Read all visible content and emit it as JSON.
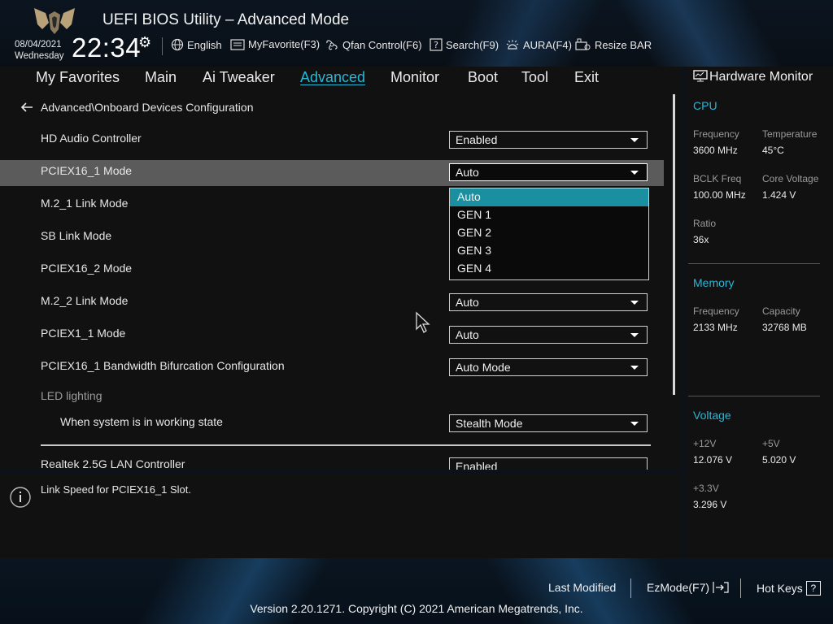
{
  "header": {
    "title": "UEFI BIOS Utility – Advanced Mode",
    "date": "08/04/2021",
    "weekday": "Wednesday",
    "time": "22:34",
    "items": [
      {
        "label": "English",
        "icon": "globe-icon"
      },
      {
        "label": "MyFavorite(F3)",
        "icon": "favorite-icon"
      },
      {
        "label": "Qfan Control(F6)",
        "icon": "fan-icon"
      },
      {
        "label": "Search(F9)",
        "icon": "search-icon"
      },
      {
        "label": "AURA(F4)",
        "icon": "aura-icon"
      },
      {
        "label": "Resize BAR",
        "icon": "resize-bar-icon"
      }
    ]
  },
  "menu": {
    "tabs": [
      "My Favorites",
      "Main",
      "Ai Tweaker",
      "Advanced",
      "Monitor",
      "Boot",
      "Tool",
      "Exit"
    ],
    "active": "Advanced"
  },
  "main": {
    "breadcrumb": "Advanced\\Onboard Devices Configuration",
    "rows": [
      {
        "label": "HD Audio Controller",
        "value": "Enabled"
      },
      {
        "label": "PCIEX16_1 Mode",
        "value": "Auto"
      },
      {
        "label": "M.2_1 Link Mode",
        "value": ""
      },
      {
        "label": "SB Link Mode",
        "value": ""
      },
      {
        "label": "PCIEX16_2 Mode",
        "value": ""
      },
      {
        "label": "M.2_2 Link Mode",
        "value": "Auto"
      },
      {
        "label": "PCIEX1_1 Mode",
        "value": "Auto"
      },
      {
        "label": "PCIEX16_1 Bandwidth Bifurcation Configuration",
        "value": "Auto Mode"
      },
      {
        "label": "LED lighting",
        "value": ""
      },
      {
        "label": "When system is in working state",
        "value": "Stealth Mode"
      },
      {
        "label": "Realtek 2.5G LAN Controller",
        "value": "Enabled"
      }
    ],
    "dropdown": {
      "options": [
        "Auto",
        "GEN 1",
        "GEN 2",
        "GEN 3",
        "GEN 4"
      ],
      "selected": "Auto"
    },
    "help_text": "Link Speed for PCIEX16_1 Slot."
  },
  "hardware_monitor": {
    "title": "Hardware Monitor",
    "cpu": {
      "section": "CPU",
      "frequency_label": "Frequency",
      "frequency": "3600 MHz",
      "temperature_label": "Temperature",
      "temperature": "45°C",
      "bclk_label": "BCLK Freq",
      "bclk": "100.00 MHz",
      "core_voltage_label": "Core Voltage",
      "core_voltage": "1.424 V",
      "ratio_label": "Ratio",
      "ratio": "36x"
    },
    "memory": {
      "section": "Memory",
      "frequency_label": "Frequency",
      "frequency": "2133 MHz",
      "capacity_label": "Capacity",
      "capacity": "32768 MB"
    },
    "voltage": {
      "section": "Voltage",
      "v12_label": "+12V",
      "v12": "12.076 V",
      "v5_label": "+5V",
      "v5": "5.020 V",
      "v33_label": "+3.3V",
      "v33": "3.296 V"
    }
  },
  "footer": {
    "last_modified": "Last Modified",
    "ezmode": "EzMode(F7)",
    "hot_keys": "Hot Keys",
    "hot_keys_icon": "?",
    "copyright": "Version 2.20.1271. Copyright (C) 2021 American Megatrends, Inc."
  },
  "colors": {
    "accent": "#27b8d8",
    "highlight_row": "#5b5b5b",
    "dropdown_selected": "#1a8fa0"
  }
}
